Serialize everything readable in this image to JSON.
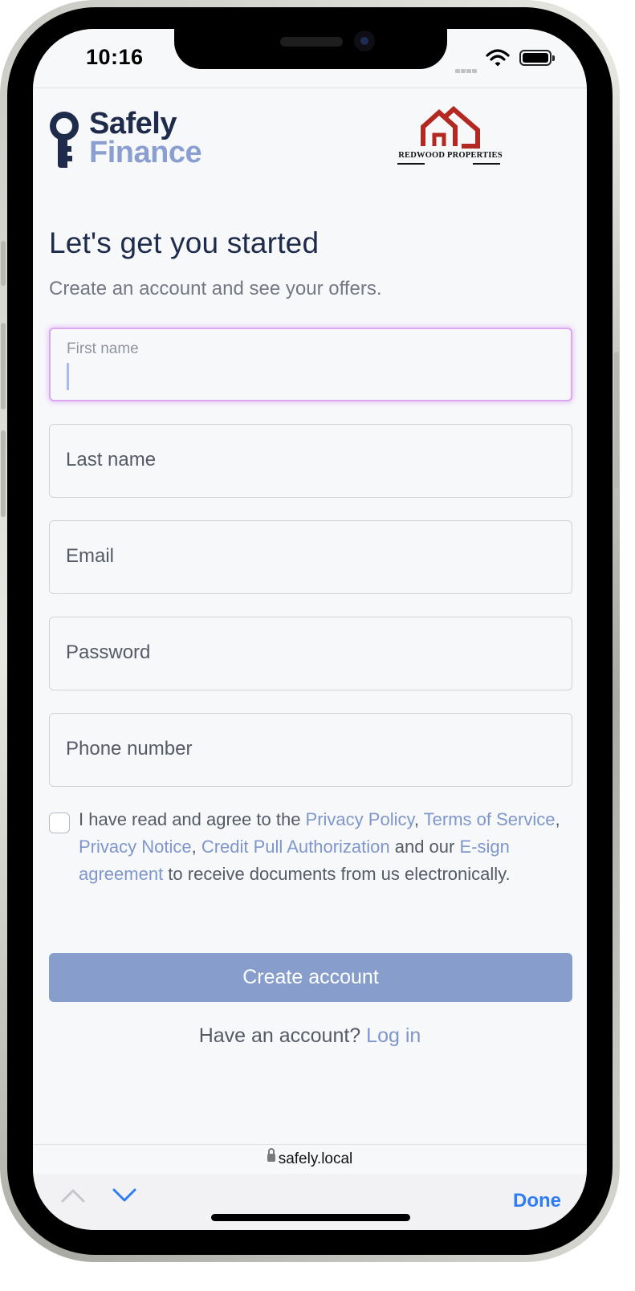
{
  "status_bar": {
    "time": "10:16"
  },
  "brand": {
    "line1": "Safely",
    "line2": "Finance",
    "partner_name": "REDWOOD PROPERTIES"
  },
  "form": {
    "title": "Let's get you started",
    "subtitle": "Create an account and see your offers.",
    "first_name_label": "First name",
    "last_name_placeholder": "Last name",
    "email_placeholder": "Email",
    "password_placeholder": "Password",
    "phone_placeholder": "Phone number"
  },
  "consent": {
    "text1": "I have read and agree to the ",
    "privacy_policy": "Privacy Policy",
    "comma1": ", ",
    "terms": "Terms of Service",
    "comma2": ", ",
    "privacy_notice": "Privacy Notice",
    "comma3": ", ",
    "credit_pull": "Credit Pull Authorization",
    "text2": " and our ",
    "esign": "E-sign agreement",
    "text3": " to receive documents from us electronically."
  },
  "actions": {
    "create_account": "Create account",
    "have_account": "Have an account? ",
    "log_in": "Log in"
  },
  "browser": {
    "url": "safely.local",
    "done": "Done"
  },
  "icons": [
    "key-icon",
    "house-icon",
    "wifi-icon",
    "battery-icon",
    "lock-icon",
    "chevron-up-icon",
    "chevron-down-icon"
  ],
  "colors": {
    "brand_dark": "#1f2b4a",
    "brand_light": "#8a9fd0",
    "link": "#7f96cc",
    "button": "#879ecc",
    "partner_red": "#b32820",
    "focus": "#dca6f0",
    "ios_blue": "#2f7cf6"
  }
}
